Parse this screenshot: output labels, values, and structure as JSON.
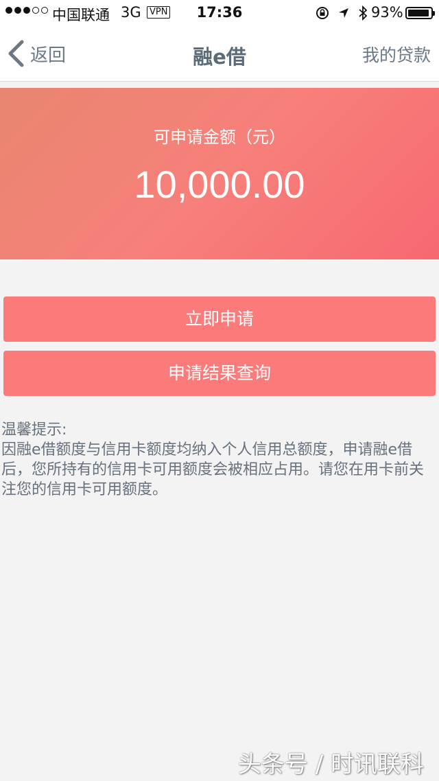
{
  "status_bar": {
    "carrier": "中国联通",
    "network": "3G",
    "vpn": "VPN",
    "time": "17:36",
    "battery": "93%",
    "battery_level": 0.93,
    "icons": [
      "rotation-lock-icon",
      "location-arrow-icon",
      "bluetooth-icon"
    ]
  },
  "nav": {
    "back_label": "返回",
    "title": "融e借",
    "right_link": "我的贷款"
  },
  "hero": {
    "label": "可申请金额（元）",
    "amount": "10,000.00",
    "colors": [
      "#e8866f",
      "#f7807a",
      "#f76872"
    ]
  },
  "actions": {
    "apply_label": "立即申请",
    "query_label": "申请结果查询",
    "button_color": "#fb7b7b"
  },
  "notice": {
    "title": "温馨提示:",
    "body": "因融e借额度与信用卡额度均纳入个人信用总额度，申请融e借后，您所持有的信用卡可用额度会被相应占用。请您在用卡前关注您的信用卡可用额度。"
  },
  "watermark": "头条号 / 时讯联科"
}
